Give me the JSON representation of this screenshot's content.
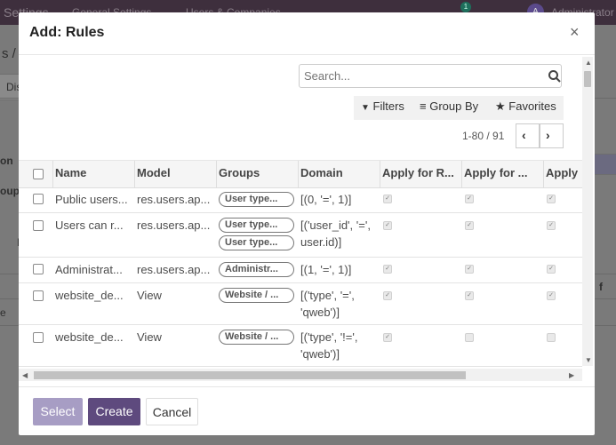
{
  "background": {
    "nav": [
      "Settings",
      "General Settings",
      "Users & Companies",
      "Administrator"
    ],
    "badge": "1",
    "avatar": "A",
    "fragments": [
      "s / I",
      "Dis",
      "on",
      "oup",
      "L",
      "e",
      "f"
    ]
  },
  "dialog": {
    "title": "Add: Rules",
    "close_glyph": "×",
    "search": {
      "placeholder": "Search...",
      "value": ""
    },
    "controls": {
      "filters": "Filters",
      "group_by": "Group By",
      "favorites": "Favorites"
    },
    "pager": {
      "value": "1-80 / 91"
    },
    "columns": [
      "Name",
      "Model",
      "Groups",
      "Domain",
      "Apply for R...",
      "Apply for ...",
      "Apply"
    ],
    "rows": [
      {
        "name": "Public users...",
        "model": "res.users.ap...",
        "groups": [
          "User type..."
        ],
        "domain": "[(0, '=', 1)]",
        "apply": [
          true,
          true,
          true
        ]
      },
      {
        "name": "Users can r...",
        "model": "res.users.ap...",
        "groups": [
          "User type...",
          "User type..."
        ],
        "domain": "[('user_id', '=', user.id)]",
        "domain_lines": [
          "[('user_id', '=',",
          "user.id)]"
        ],
        "apply": [
          true,
          true,
          true
        ]
      },
      {
        "name": "Administrat...",
        "model": "res.users.ap...",
        "groups": [
          "Administr..."
        ],
        "domain": "[(1, '=', 1)]",
        "apply": [
          true,
          true,
          true
        ]
      },
      {
        "name": "website_de...",
        "model": "View",
        "groups": [
          "Website / ..."
        ],
        "domain": "[('type', '=', 'qweb')]",
        "domain_lines": [
          "[('type', '=',",
          "'qweb')]"
        ],
        "apply": [
          true,
          true,
          true
        ]
      },
      {
        "name": "website_de...",
        "model": "View",
        "groups": [
          "Website / ..."
        ],
        "domain": "[('type', '!=', 'qweb')]",
        "domain_lines": [
          "[('type', '!=',",
          "'qweb')]"
        ],
        "apply": [
          true,
          false,
          false
        ]
      }
    ],
    "buttons": {
      "select": "Select",
      "create": "Create",
      "cancel": "Cancel"
    }
  },
  "colors": {
    "primary": "#5e4a7e",
    "primary_disabled": "#a79dc4",
    "overlay": "#7a7a7a"
  }
}
